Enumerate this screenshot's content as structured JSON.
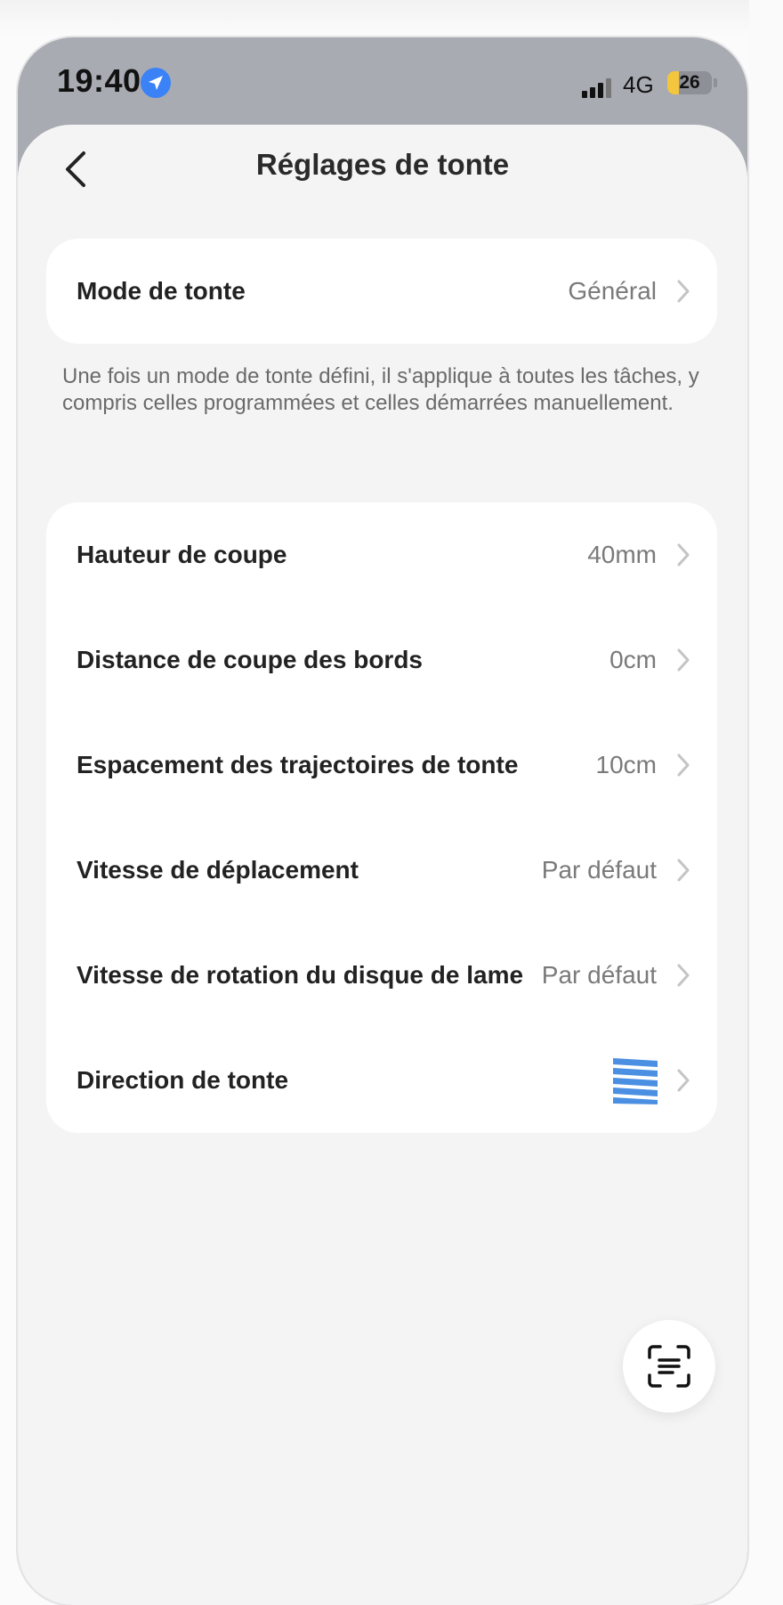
{
  "status_bar": {
    "time": "19:40",
    "network": "4G",
    "battery_level": "26",
    "battery_fraction": 0.26,
    "location_icon": "location-arrow-icon",
    "signal_icon": "cellular-signal-icon"
  },
  "header": {
    "title": "Réglages de tonte",
    "back_icon": "chevron-left-icon"
  },
  "mode_card": {
    "label": "Mode de tonte",
    "value": "Général"
  },
  "mode_description": "Une fois un mode de tonte défini, il s'applique à toutes les tâches, y compris celles programmées et celles démarrées manuellement.",
  "settings": [
    {
      "label": "Hauteur de coupe",
      "value": "40mm"
    },
    {
      "label": "Distance de coupe des bords",
      "value": "0cm"
    },
    {
      "label": "Espacement des trajectoires de tonte",
      "value": "10cm"
    },
    {
      "label": "Vitesse de déplacement",
      "value": "Par défaut"
    },
    {
      "label": "Vitesse de rotation du disque de lame",
      "value": "Par défaut"
    },
    {
      "label": "Direction de tonte",
      "value_icon": "stripes-direction-icon"
    }
  ],
  "fab": {
    "icon": "scan-text-icon"
  },
  "colors": {
    "accent": "#3b82f6",
    "direction_stripes": "#4a8fe2",
    "battery": "#f4c63d"
  }
}
